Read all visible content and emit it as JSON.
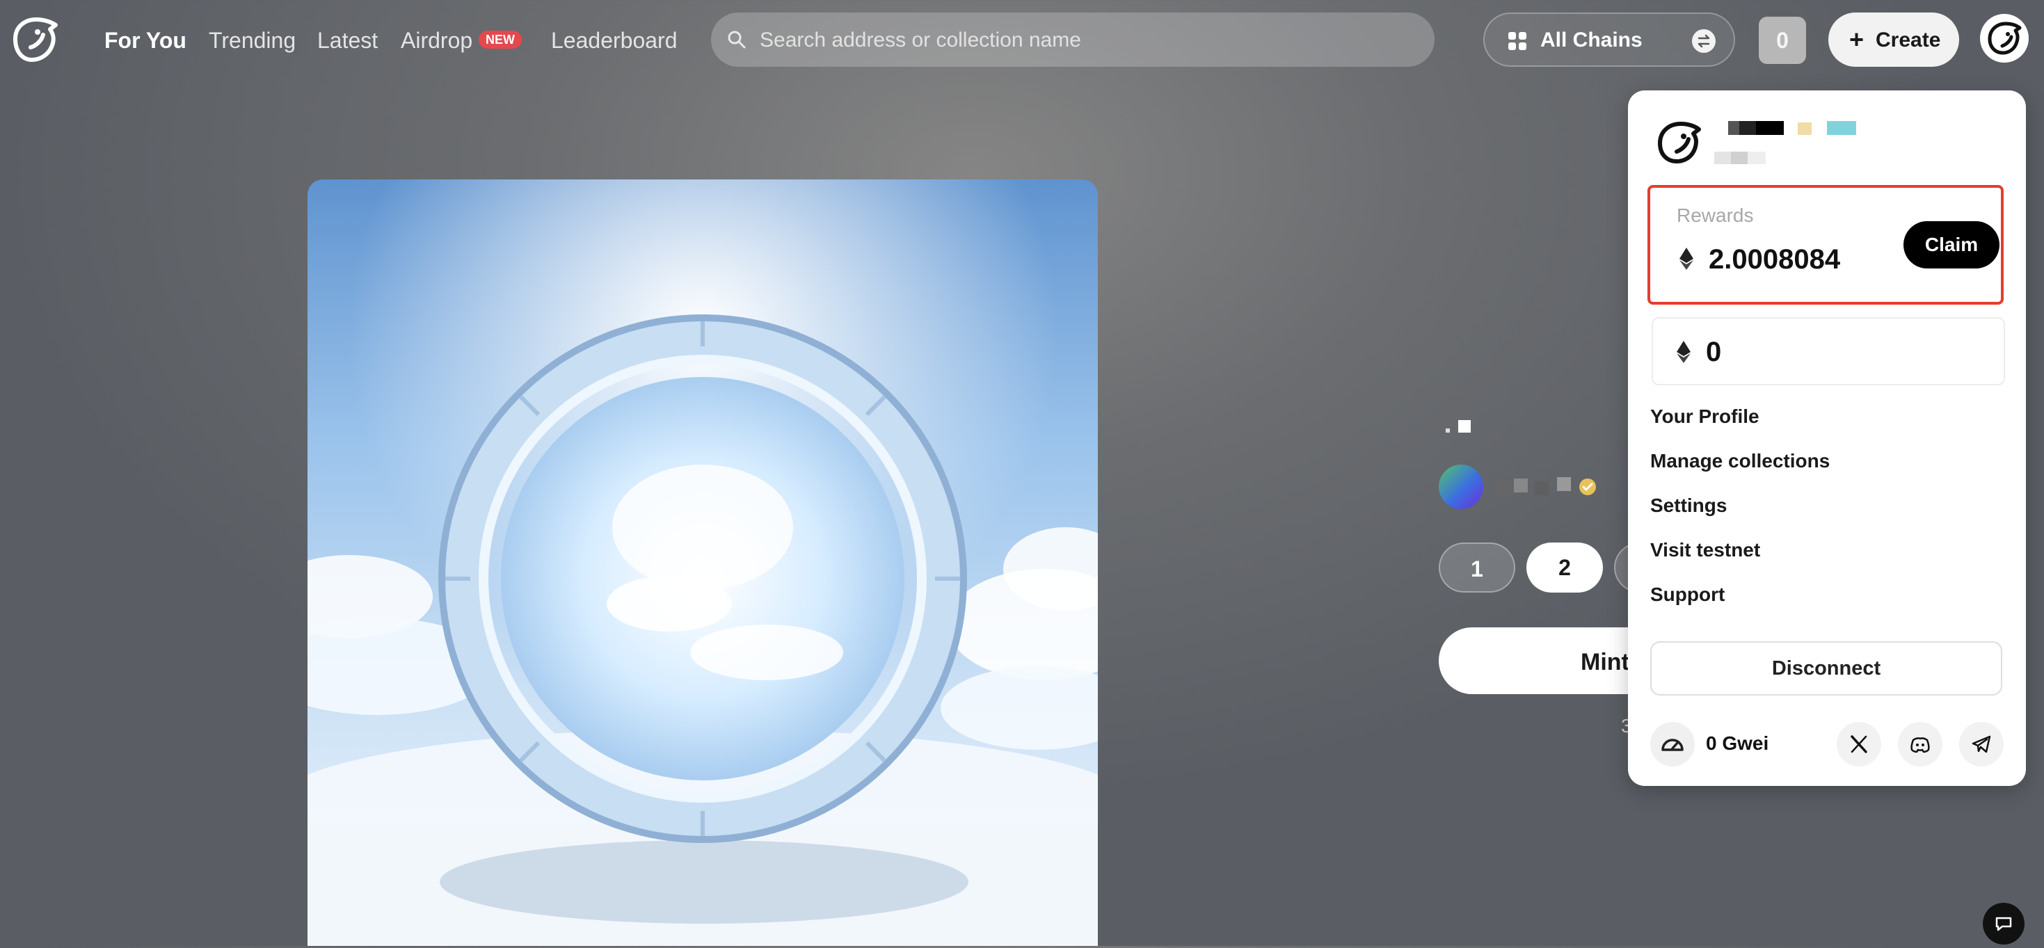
{
  "nav": {
    "logo_icon": "bird-logo-icon",
    "links": [
      "For You",
      "Trending",
      "Latest",
      "Airdrop",
      "Leaderboard"
    ],
    "active": "For You",
    "airdrop_badge": "NEW"
  },
  "search": {
    "placeholder": "Search address or collection name",
    "icon": "search-icon"
  },
  "chains": {
    "label": "All Chains",
    "icon": "grid-icon",
    "toggle_icon": "swap-icon"
  },
  "counter": "0",
  "create": {
    "label": "Create",
    "icon": "plus-icon"
  },
  "mint_panel": {
    "quantities": [
      "1",
      "2"
    ],
    "selected_quantity": "2",
    "mint_label": "Mint",
    "footer_fragment": "3"
  },
  "dropdown": {
    "rewards": {
      "label": "Rewards",
      "amount": "2.0008084",
      "currency_icon": "ethereum-icon",
      "claim_label": "Claim"
    },
    "balance": {
      "amount": "0",
      "currency_icon": "ethereum-icon"
    },
    "menu": [
      "Your Profile",
      "Manage collections",
      "Settings",
      "Visit testnet",
      "Support"
    ],
    "disconnect_label": "Disconnect",
    "gas_label": "0 Gwei",
    "social_icons": [
      "x-icon",
      "discord-icon",
      "telegram-icon"
    ]
  },
  "colors": {
    "highlight_border": "#e43d2f",
    "badge_new": "#e5484d",
    "claim_button": "#000000"
  }
}
